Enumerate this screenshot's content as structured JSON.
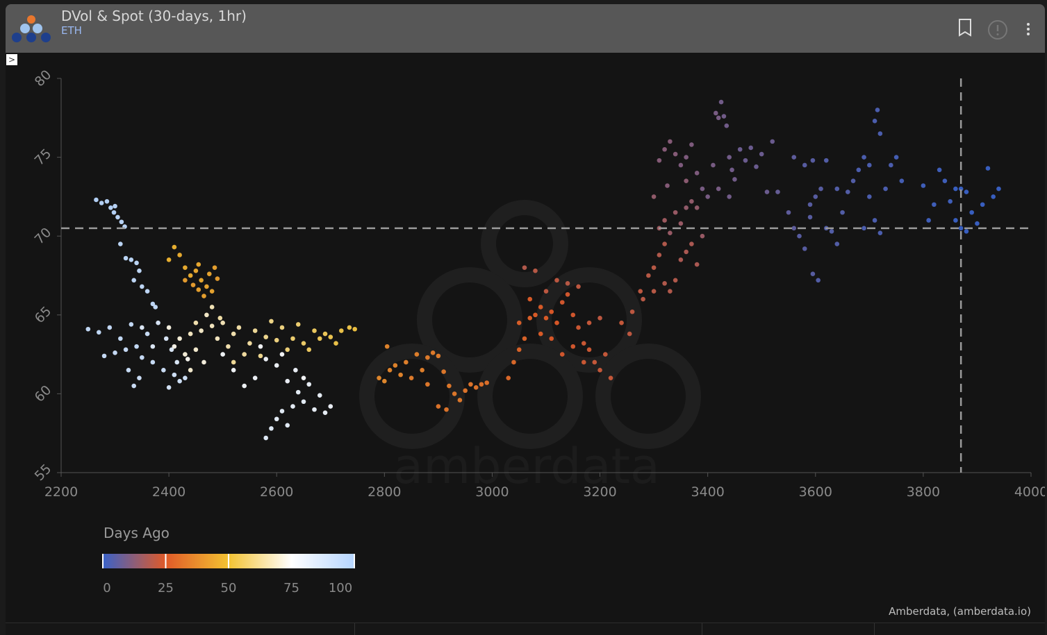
{
  "header": {
    "title": "DVol & Spot (30-days, 1hr)",
    "subtitle": "ETH",
    "expander_label": ">"
  },
  "icons": {
    "bookmark": "bookmark-icon",
    "info": "alert-circle-icon",
    "menu": "more-vertical-icon"
  },
  "watermark": "amberdata",
  "credit": "Amberdata, (amberdata.io)",
  "chart_data": {
    "type": "scatter",
    "title": "DVol & Spot (30-days, 1hr)",
    "xlabel": "",
    "ylabel": "",
    "xlim": [
      2200,
      4000
    ],
    "ylim": [
      55,
      80
    ],
    "xticks": [
      2200,
      2400,
      2600,
      2800,
      3000,
      3200,
      3400,
      3600,
      3800,
      4000
    ],
    "yticks": [
      55,
      60,
      65,
      70,
      75,
      80
    ],
    "crosshair": {
      "x": 3870,
      "y": 70.5
    },
    "colorbar": {
      "title": "Days Ago",
      "ticks": [
        0,
        25,
        50,
        75,
        100
      ],
      "range": [
        0,
        100
      ],
      "stops": [
        [
          0,
          "#3a62c8"
        ],
        [
          25,
          "#e05a28"
        ],
        [
          50,
          "#f3c232"
        ],
        [
          75,
          "#ffffff"
        ],
        [
          100,
          "#b6d6ff"
        ]
      ]
    },
    "points_format": [
      "spot",
      "dvol",
      "days_ago"
    ],
    "points": [
      [
        2265,
        72.3,
        99
      ],
      [
        2275,
        72.1,
        99
      ],
      [
        2285,
        72.2,
        98
      ],
      [
        2292,
        71.8,
        98
      ],
      [
        2298,
        71.5,
        98
      ],
      [
        2305,
        71.2,
        97
      ],
      [
        2312,
        70.9,
        97
      ],
      [
        2300,
        71.9,
        97
      ],
      [
        2318,
        70.6,
        97
      ],
      [
        2310,
        69.5,
        96
      ],
      [
        2320,
        68.6,
        96
      ],
      [
        2330,
        68.5,
        96
      ],
      [
        2340,
        68.3,
        96
      ],
      [
        2345,
        67.8,
        95
      ],
      [
        2335,
        67.2,
        95
      ],
      [
        2350,
        66.8,
        95
      ],
      [
        2360,
        66.5,
        95
      ],
      [
        2370,
        65.7,
        95
      ],
      [
        2375,
        65.5,
        94
      ],
      [
        2250,
        64.1,
        94
      ],
      [
        2270,
        63.9,
        94
      ],
      [
        2290,
        64.2,
        93
      ],
      [
        2310,
        63.5,
        93
      ],
      [
        2330,
        64.4,
        93
      ],
      [
        2340,
        63.0,
        93
      ],
      [
        2300,
        62.6,
        92
      ],
      [
        2280,
        62.4,
        92
      ],
      [
        2320,
        62.8,
        92
      ],
      [
        2350,
        62.3,
        92
      ],
      [
        2360,
        63.8,
        91
      ],
      [
        2370,
        62.0,
        91
      ],
      [
        2325,
        61.5,
        91
      ],
      [
        2345,
        61.0,
        90
      ],
      [
        2335,
        60.5,
        90
      ],
      [
        2390,
        61.5,
        90
      ],
      [
        2410,
        61.2,
        89
      ],
      [
        2420,
        60.8,
        89
      ],
      [
        2430,
        61.0,
        89
      ],
      [
        2400,
        60.4,
        88
      ],
      [
        2380,
        64.5,
        86
      ],
      [
        2395,
        63.5,
        86
      ],
      [
        2405,
        62.8,
        85
      ],
      [
        2415,
        62.0,
        85
      ],
      [
        2370,
        63.0,
        84
      ],
      [
        2350,
        64.2,
        84
      ],
      [
        2580,
        57.2,
        83
      ],
      [
        2590,
        57.8,
        83
      ],
      [
        2600,
        58.4,
        82
      ],
      [
        2610,
        58.9,
        82
      ],
      [
        2620,
        58.0,
        82
      ],
      [
        2630,
        59.2,
        81
      ],
      [
        2640,
        60.1,
        81
      ],
      [
        2650,
        59.5,
        81
      ],
      [
        2660,
        60.6,
        80
      ],
      [
        2670,
        59.0,
        80
      ],
      [
        2680,
        59.9,
        80
      ],
      [
        2690,
        58.8,
        80
      ],
      [
        2700,
        59.2,
        79
      ],
      [
        2620,
        60.8,
        79
      ],
      [
        2635,
        61.5,
        79
      ],
      [
        2600,
        61.8,
        78
      ],
      [
        2580,
        62.2,
        78
      ],
      [
        2560,
        61.0,
        78
      ],
      [
        2540,
        60.5,
        77
      ],
      [
        2520,
        61.5,
        77
      ],
      [
        2500,
        62.5,
        77
      ],
      [
        2650,
        61.0,
        76
      ],
      [
        2610,
        62.5,
        76
      ],
      [
        2570,
        63.0,
        76
      ],
      [
        2400,
        64.2,
        72
      ],
      [
        2420,
        63.5,
        71
      ],
      [
        2430,
        62.5,
        71
      ],
      [
        2440,
        61.5,
        70
      ],
      [
        2450,
        62.8,
        70
      ],
      [
        2460,
        64.0,
        69
      ],
      [
        2470,
        65.0,
        69
      ],
      [
        2480,
        64.3,
        68
      ],
      [
        2490,
        63.5,
        68
      ],
      [
        2500,
        64.5,
        67
      ],
      [
        2510,
        63.0,
        66
      ],
      [
        2520,
        63.8,
        66
      ],
      [
        2530,
        64.2,
        65
      ],
      [
        2540,
        62.5,
        64
      ],
      [
        2550,
        63.2,
        64
      ],
      [
        2560,
        64.0,
        63
      ],
      [
        2570,
        62.4,
        62
      ],
      [
        2580,
        63.6,
        62
      ],
      [
        2590,
        64.6,
        61
      ],
      [
        2600,
        63.4,
        60
      ],
      [
        2610,
        64.2,
        60
      ],
      [
        2620,
        62.8,
        59
      ],
      [
        2630,
        63.5,
        58
      ],
      [
        2640,
        64.4,
        58
      ],
      [
        2650,
        63.2,
        57
      ],
      [
        2660,
        62.8,
        56
      ],
      [
        2670,
        64.0,
        56
      ],
      [
        2680,
        63.5,
        55
      ],
      [
        2690,
        63.8,
        55
      ],
      [
        2700,
        63.6,
        54
      ],
      [
        2720,
        64.0,
        53
      ],
      [
        2735,
        64.2,
        53
      ],
      [
        2745,
        64.1,
        52
      ],
      [
        2710,
        63.2,
        53
      ],
      [
        2450,
        64.5,
        66
      ],
      [
        2480,
        65.5,
        67
      ],
      [
        2495,
        64.8,
        65
      ],
      [
        2520,
        62.0,
        63
      ],
      [
        2440,
        63.8,
        68
      ],
      [
        2410,
        63.0,
        73
      ],
      [
        2435,
        62.2,
        74
      ],
      [
        2465,
        62.0,
        72
      ],
      [
        2400,
        68.5,
        47
      ],
      [
        2410,
        69.3,
        47
      ],
      [
        2420,
        68.8,
        46
      ],
      [
        2430,
        68.0,
        46
      ],
      [
        2440,
        67.5,
        46
      ],
      [
        2450,
        67.8,
        45
      ],
      [
        2455,
        68.2,
        45
      ],
      [
        2460,
        67.2,
        45
      ],
      [
        2470,
        66.8,
        44
      ],
      [
        2475,
        67.6,
        44
      ],
      [
        2480,
        66.5,
        44
      ],
      [
        2485,
        68.0,
        43
      ],
      [
        2465,
        66.2,
        43
      ],
      [
        2455,
        66.6,
        43
      ],
      [
        2445,
        66.9,
        42
      ],
      [
        2430,
        67.2,
        42
      ],
      [
        2490,
        67.3,
        42
      ],
      [
        2790,
        61.0,
        37
      ],
      [
        2800,
        60.8,
        37
      ],
      [
        2810,
        61.5,
        36
      ],
      [
        2820,
        61.8,
        36
      ],
      [
        2830,
        61.2,
        36
      ],
      [
        2840,
        62.0,
        35
      ],
      [
        2860,
        62.5,
        35
      ],
      [
        2870,
        61.5,
        35
      ],
      [
        2880,
        62.3,
        34
      ],
      [
        2890,
        62.6,
        34
      ],
      [
        2900,
        62.4,
        34
      ],
      [
        2910,
        61.4,
        33
      ],
      [
        2920,
        60.5,
        33
      ],
      [
        2930,
        60.0,
        33
      ],
      [
        2940,
        59.6,
        33
      ],
      [
        2950,
        60.2,
        32
      ],
      [
        2960,
        60.6,
        32
      ],
      [
        2970,
        60.4,
        32
      ],
      [
        2980,
        60.6,
        31
      ],
      [
        2990,
        60.7,
        31
      ],
      [
        2900,
        59.2,
        32
      ],
      [
        2915,
        59.0,
        32
      ],
      [
        2880,
        60.6,
        33
      ],
      [
        2850,
        61.0,
        34
      ],
      [
        2805,
        63.0,
        36
      ],
      [
        3030,
        61.0,
        29
      ],
      [
        3040,
        62.0,
        29
      ],
      [
        3050,
        62.8,
        28
      ],
      [
        3060,
        63.5,
        28
      ],
      [
        3050,
        64.5,
        27
      ],
      [
        3070,
        64.8,
        27
      ],
      [
        3080,
        65.0,
        26
      ],
      [
        3090,
        65.5,
        26
      ],
      [
        3100,
        64.8,
        26
      ],
      [
        3110,
        65.2,
        25
      ],
      [
        3120,
        64.5,
        25
      ],
      [
        3130,
        65.8,
        24
      ],
      [
        3140,
        66.3,
        24
      ],
      [
        3150,
        65.0,
        24
      ],
      [
        3160,
        64.2,
        23
      ],
      [
        3170,
        63.2,
        23
      ],
      [
        3180,
        62.8,
        23
      ],
      [
        3190,
        62.0,
        22
      ],
      [
        3200,
        61.5,
        22
      ],
      [
        3210,
        62.5,
        22
      ],
      [
        3220,
        61.0,
        22
      ],
      [
        3110,
        63.5,
        25
      ],
      [
        3130,
        62.5,
        24
      ],
      [
        3150,
        63.0,
        24
      ],
      [
        3170,
        62.0,
        23
      ],
      [
        3100,
        66.5,
        21
      ],
      [
        3120,
        67.2,
        21
      ],
      [
        3140,
        67.0,
        20
      ],
      [
        3080,
        67.8,
        20
      ],
      [
        3060,
        68.0,
        19
      ],
      [
        3160,
        66.8,
        21
      ],
      [
        3180,
        64.5,
        22
      ],
      [
        3200,
        64.8,
        21
      ],
      [
        3090,
        63.8,
        26
      ],
      [
        3070,
        66.0,
        26
      ],
      [
        3240,
        64.5,
        22
      ],
      [
        3260,
        65.2,
        21
      ],
      [
        3275,
        66.5,
        21
      ],
      [
        3280,
        66.0,
        20
      ],
      [
        3290,
        67.5,
        20
      ],
      [
        3300,
        68.0,
        20
      ],
      [
        3310,
        68.8,
        19
      ],
      [
        3320,
        67.0,
        19
      ],
      [
        3330,
        66.5,
        19
      ],
      [
        3340,
        67.2,
        19
      ],
      [
        3350,
        68.5,
        18
      ],
      [
        3360,
        69.0,
        18
      ],
      [
        3370,
        69.5,
        18
      ],
      [
        3380,
        68.2,
        18
      ],
      [
        3300,
        66.5,
        20
      ],
      [
        3320,
        69.5,
        19
      ],
      [
        3255,
        63.8,
        21
      ],
      [
        3310,
        70.5,
        16
      ],
      [
        3320,
        71.0,
        16
      ],
      [
        3330,
        70.2,
        15
      ],
      [
        3340,
        71.5,
        15
      ],
      [
        3350,
        70.8,
        15
      ],
      [
        3360,
        71.8,
        14
      ],
      [
        3370,
        72.2,
        14
      ],
      [
        3380,
        71.8,
        14
      ],
      [
        3390,
        70.0,
        15
      ],
      [
        3310,
        74.8,
        12
      ],
      [
        3320,
        75.5,
        12
      ],
      [
        3330,
        76.0,
        12
      ],
      [
        3340,
        75.2,
        12
      ],
      [
        3350,
        74.5,
        11
      ],
      [
        3360,
        75.0,
        11
      ],
      [
        3370,
        75.8,
        11
      ],
      [
        3380,
        74.0,
        11
      ],
      [
        3390,
        73.0,
        10
      ],
      [
        3400,
        72.5,
        10
      ],
      [
        3410,
        74.5,
        10
      ],
      [
        3415,
        77.8,
        10
      ],
      [
        3420,
        77.5,
        10
      ],
      [
        3425,
        78.5,
        9
      ],
      [
        3430,
        77.6,
        9
      ],
      [
        3435,
        77.0,
        9
      ],
      [
        3440,
        75.0,
        9
      ],
      [
        3445,
        74.2,
        9
      ],
      [
        3450,
        73.6,
        9
      ],
      [
        3460,
        75.5,
        8
      ],
      [
        3470,
        74.8,
        8
      ],
      [
        3480,
        75.6,
        8
      ],
      [
        3490,
        74.4,
        8
      ],
      [
        3500,
        75.2,
        8
      ],
      [
        3510,
        72.8,
        8
      ],
      [
        3520,
        76.0,
        8
      ],
      [
        3530,
        72.8,
        7
      ],
      [
        3325,
        73.2,
        12
      ],
      [
        3420,
        73.0,
        10
      ],
      [
        3440,
        72.5,
        9
      ],
      [
        3300,
        72.5,
        14
      ],
      [
        3360,
        73.5,
        13
      ],
      [
        3560,
        75.0,
        6
      ],
      [
        3550,
        71.5,
        6
      ],
      [
        3560,
        70.5,
        6
      ],
      [
        3570,
        70.0,
        5
      ],
      [
        3580,
        69.2,
        5
      ],
      [
        3590,
        71.2,
        5
      ],
      [
        3600,
        72.5,
        5
      ],
      [
        3610,
        73.0,
        5
      ],
      [
        3595,
        74.8,
        5
      ],
      [
        3620,
        70.5,
        4
      ],
      [
        3630,
        70.3,
        4
      ],
      [
        3640,
        69.5,
        4
      ],
      [
        3650,
        71.5,
        4
      ],
      [
        3660,
        72.8,
        4
      ],
      [
        3670,
        73.5,
        4
      ],
      [
        3680,
        74.2,
        3
      ],
      [
        3690,
        75.0,
        3
      ],
      [
        3700,
        74.5,
        3
      ],
      [
        3710,
        77.3,
        3
      ],
      [
        3715,
        78.0,
        3
      ],
      [
        3720,
        76.5,
        3
      ],
      [
        3700,
        72.5,
        3
      ],
      [
        3710,
        71.0,
        3
      ],
      [
        3720,
        70.2,
        3
      ],
      [
        3730,
        73.0,
        3
      ],
      [
        3740,
        74.5,
        3
      ],
      [
        3750,
        75.0,
        2
      ],
      [
        3690,
        70.5,
        3
      ],
      [
        3605,
        67.2,
        4
      ],
      [
        3595,
        67.6,
        5
      ],
      [
        3590,
        72.0,
        5
      ],
      [
        3580,
        74.5,
        5
      ],
      [
        3620,
        74.8,
        4
      ],
      [
        3640,
        73.0,
        4
      ],
      [
        3760,
        73.5,
        2
      ],
      [
        3800,
        73.2,
        1
      ],
      [
        3810,
        71.0,
        1
      ],
      [
        3820,
        72.0,
        1
      ],
      [
        3830,
        74.2,
        1
      ],
      [
        3840,
        73.5,
        1
      ],
      [
        3850,
        72.2,
        1
      ],
      [
        3860,
        71.0,
        0
      ],
      [
        3870,
        70.5,
        0
      ],
      [
        3880,
        72.8,
        0
      ],
      [
        3890,
        71.5,
        0
      ],
      [
        3900,
        70.8,
        0
      ],
      [
        3910,
        72.0,
        0
      ],
      [
        3920,
        74.3,
        0
      ],
      [
        3930,
        72.5,
        0
      ],
      [
        3940,
        73.0,
        0
      ],
      [
        3860,
        73.0,
        0
      ],
      [
        3880,
        70.3,
        0
      ],
      [
        3870,
        73.0,
        0
      ]
    ]
  }
}
